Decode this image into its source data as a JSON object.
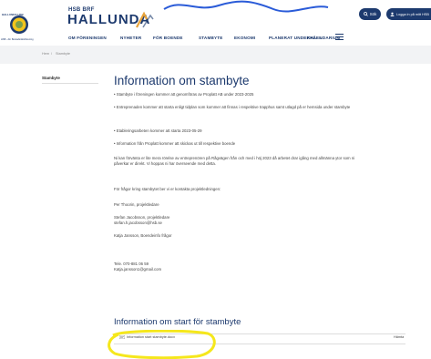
{
  "header": {
    "seal_top_text": "HALLUNDA HSB",
    "seal_bottom_text": "HSB - din Bostadsrättsförening",
    "brand_small": "HSB BRF",
    "brand_name": "HALLUNDA",
    "search_label": "Sök",
    "login_label": "Logga in på mitt HSB",
    "nav": [
      "OM FÖRENINGEN",
      "NYHETER",
      "FÖR BOENDE",
      "STAMBYTE",
      "EKONOMI",
      "PLANERAT UNDERHÅLL",
      "KALENDARIUM"
    ]
  },
  "breadcrumb": {
    "home": "Hem",
    "separator": "/",
    "current": "Stambyte"
  },
  "sidebar": {
    "title": "Stambyte"
  },
  "main": {
    "title": "Information om stambyte",
    "paragraphs": [
      "• Stambyte i föreningen kommer att genomföras av Proplatt AB under 2023-2025",
      "• Entreprenaden kommer att starta enligt tidplan som kommer att finnas i respektive trapphus samt utlagd på er hemsida under stambyte",
      "• Etableringsarbeten kommer att starta 2023-05-29",
      "• Information från Proplatt kommer att skickas ut till respektive boende",
      "Ni kan förvänta er lite mera rörelse av entreprenören på Rågvägen från och med i höj 2023 då arbetet drar igång med allmänna ytor som ni påverkar er direkt. Vi hoppas ni har överseende med detta.",
      "För frågor kring stambytet ber vi er kontakta projektledningen:",
      "Per Thoorin, projektledare",
      "Stefan Jacobsson, projektledare\nstefan.h.jacobsson@hsb.se",
      "Katja Jansson, Boendeinfo frågor",
      "Tele. 070-881 06 59\nKatja.jansson1@gmail.com"
    ],
    "section_title": "Information om start för stambyte",
    "document": {
      "name": "Information start stambyte.docx",
      "action": "Hämta"
    }
  },
  "colors": {
    "brand_navy": "#1d3a6e",
    "highlight_yellow": "#f5e71c",
    "accent_orange": "#e8a33a"
  }
}
